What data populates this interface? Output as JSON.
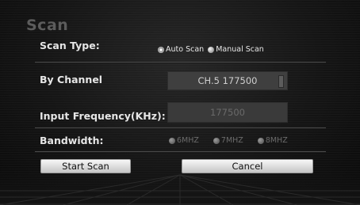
{
  "dialog": {
    "title": "Scan"
  },
  "scan_type": {
    "label": "Scan Type:",
    "options": [
      {
        "label": "Auto Scan",
        "selected": true
      },
      {
        "label": "Manual Scan",
        "selected": false
      }
    ]
  },
  "by_channel": {
    "label": "By Channel",
    "value": "CH.5  177500"
  },
  "input_frequency": {
    "label": "Input Frequency(KHz):",
    "value": "177500"
  },
  "bandwidth": {
    "label": "Bandwidth:",
    "options": [
      {
        "label": "6MHZ",
        "selected": false
      },
      {
        "label": "7MHZ",
        "selected": false
      },
      {
        "label": "8MHZ",
        "selected": false
      }
    ]
  },
  "buttons": {
    "start_scan": "Start Scan",
    "cancel": "Cancel"
  }
}
